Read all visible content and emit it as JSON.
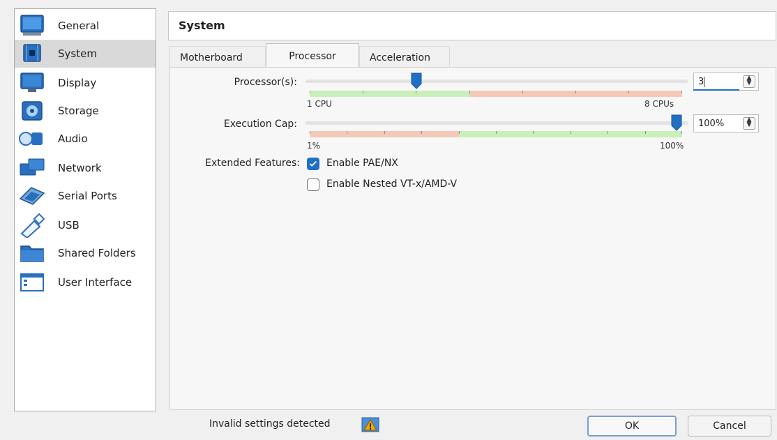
{
  "sidebar": {
    "items": [
      {
        "label": "General",
        "icon": "monitor-icon"
      },
      {
        "label": "System",
        "icon": "chip-icon"
      },
      {
        "label": "Display",
        "icon": "display-icon"
      },
      {
        "label": "Storage",
        "icon": "disk-icon"
      },
      {
        "label": "Audio",
        "icon": "speaker-icon"
      },
      {
        "label": "Network",
        "icon": "network-icon"
      },
      {
        "label": "Serial Ports",
        "icon": "serial-port-icon"
      },
      {
        "label": "USB",
        "icon": "usb-icon"
      },
      {
        "label": "Shared Folders",
        "icon": "folder-icon"
      },
      {
        "label": "User Interface",
        "icon": "window-icon"
      }
    ],
    "selected": "System"
  },
  "header": {
    "title": "System"
  },
  "tabs": [
    {
      "label": "Motherboard"
    },
    {
      "label": "Processor"
    },
    {
      "label": "Acceleration"
    }
  ],
  "processor": {
    "label": "Processor(s):",
    "value": "3",
    "min_label": "1 CPU",
    "max_label": "8 CPUs",
    "slider_value": 3,
    "slider_min": 1,
    "slider_max": 8
  },
  "execution_cap": {
    "label": "Execution Cap:",
    "value": "100%",
    "min_label": "1%",
    "max_label": "100%",
    "slider_value": 100
  },
  "extended_features": {
    "label": "Extended Features:",
    "pae_label": "Enable PAE/NX",
    "pae_checked": true,
    "nested_label": "Enable Nested VT-x/AMD-V",
    "nested_checked": false
  },
  "footer": {
    "status_text": "Invalid settings detected",
    "ok_label": "OK",
    "cancel_label": "Cancel"
  },
  "colors": {
    "accent": "#1f6fc4",
    "scale_green": "#c8f0b8",
    "scale_red": "#f5c9b8",
    "warning": "#f0a800"
  }
}
